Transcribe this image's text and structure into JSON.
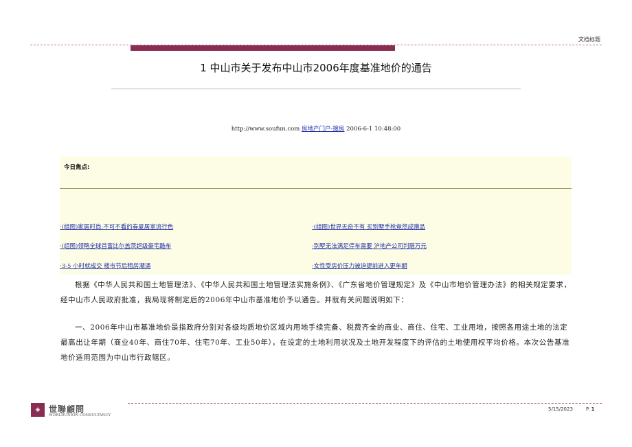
{
  "header": {
    "doc_label": "文档标题"
  },
  "title": "1  中山市关于发布中山市2006年度基准地价的通告",
  "source": {
    "url": "http://www.soufun.com",
    "site_link": "房地产门户-搜房",
    "datetime": "2006-6-1 10:48:00"
  },
  "focus": {
    "title": "今日焦点:",
    "links_left": [
      "·(组图)家居时尚:不可不看的春夏居室流行色",
      "·(组图)领略全球首富比尔盖茨超级豪宅酷车",
      "·3-5 小时就成交  楼市节后租房潮涌"
    ],
    "links_right": [
      "·(组图)世界无奇不有  买别墅手枪竟然成赠品",
      "·别墅无法满足停车需要  沪地产公司判赔万元",
      "·女性受房价压力被迫提前进入更年期"
    ]
  },
  "paragraphs": [
    "根据《中华人民共和国土地管理法》、《中华人民共和国土地管理法实施条例》、《广东省地价管理规定》及《中山市地价管理办法》的相关规定要求，经中山市人民政府批准，我局现将制定后的2006年中山市基准地价予以通告。并就有关问题说明如下：",
    "一、2006年中山市基准地价是指政府分别对各级均质地价区域内用地手续完备、税费齐全的商业、商住、住宅、工业用地，按照各用途土地的法定最高出让年期（商业40年、商住70年、住宅70年、工业50年），在设定的土地利用状况及土地开发程度下的评估的土地使用权平均价格。本次公告基准地价适用范围为中山市行政辖区。"
  ],
  "footer": {
    "logo_cn": "世聯顧問",
    "logo_en": "WORLDUNION CONSULTANCY",
    "date": "5/15/2023",
    "page_prefix": "P.",
    "page_number": "1"
  },
  "colors": {
    "accent": "#8a2d52",
    "link": "#2233aa",
    "focus_bg": "#fdfde6"
  }
}
